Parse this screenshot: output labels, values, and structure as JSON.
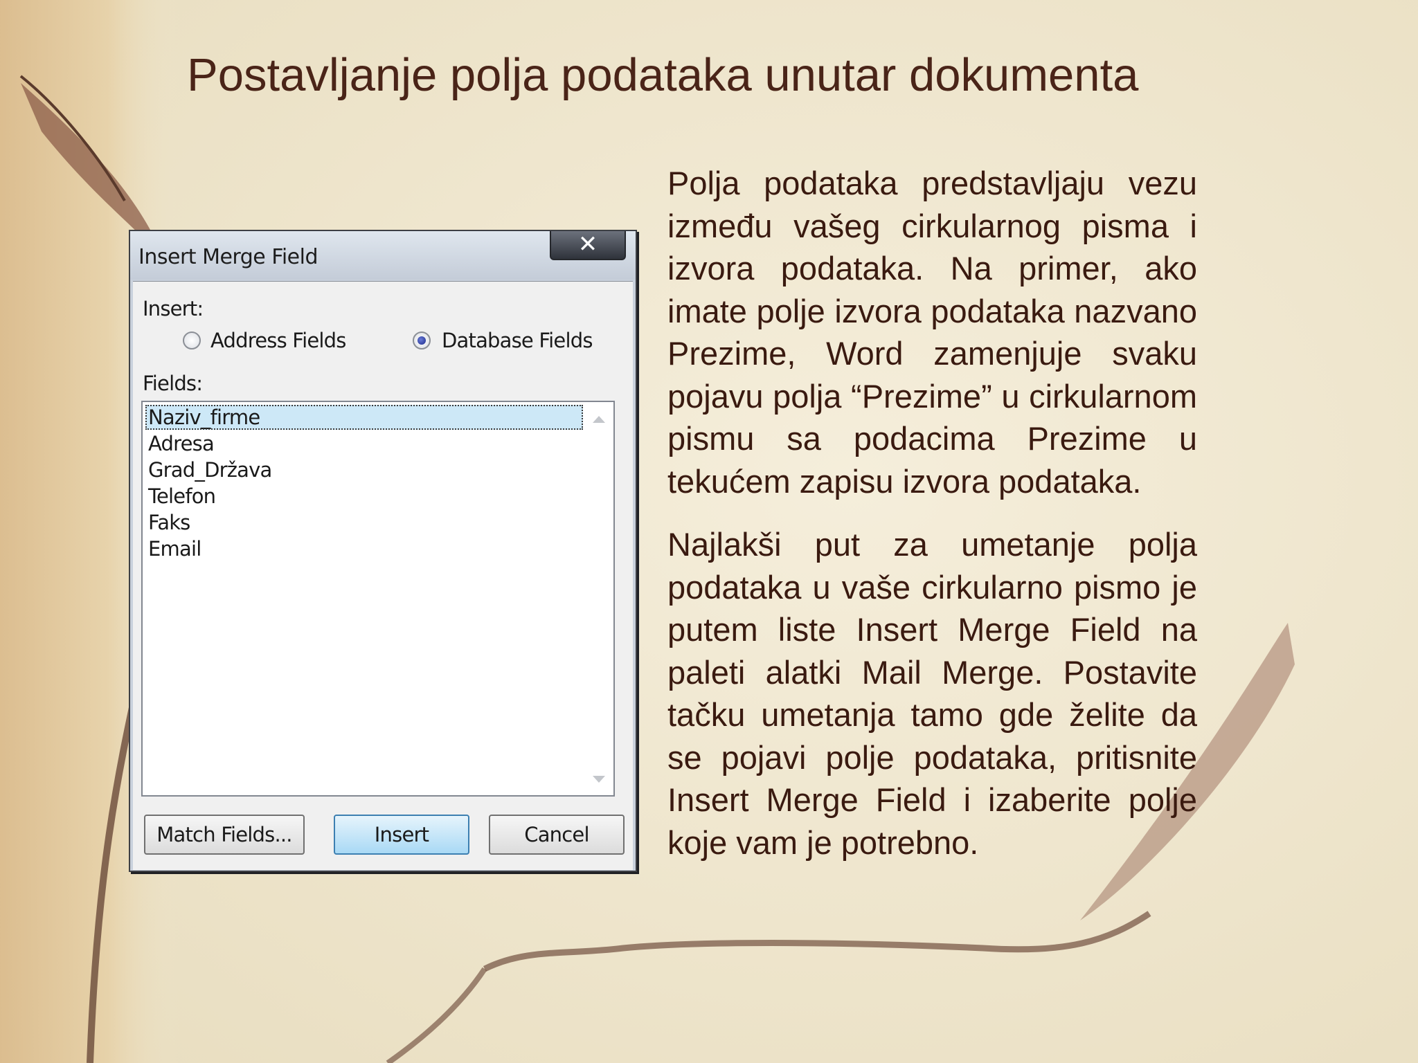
{
  "slide": {
    "title": "Postavljanje polja podataka unutar dokumenta",
    "paragraphs": [
      "Polja podataka predstavljaju vezu između vašeg cirkularnog pisma i izvora podataka. Na primer, ako imate polje izvora podataka nazvano Prezime, Word zamenjuje svaku pojavu polja “Prezime” u cirkularnom pismu sa podacima Prezime u tekućem zapisu izvora podataka.",
      "Najlakši put za umetanje polja podataka u vaše cirkularno pismo je putem liste Insert Merge Field na paleti alatki Mail Merge. Postavite tačku umetanja tamo gde želite da se pojavi polje podataka, pritisnite Insert Merge Field i izaberite polje koje vam je potrebno."
    ]
  },
  "dialog": {
    "title": "Insert Merge Field",
    "close_icon": "x-close-icon",
    "insert_label": "Insert:",
    "radio_address": "Address Fields",
    "radio_database": "Database Fields",
    "selected_radio": "Database Fields",
    "fields_label": "Fields:",
    "fields": [
      "Naziv_firme",
      "Adresa",
      "Grad_Država",
      "Telefon",
      "Faks",
      "Email"
    ],
    "selected_field": "Naziv_firme",
    "buttons": {
      "match": "Match Fields...",
      "insert": "Insert",
      "cancel": "Cancel"
    }
  },
  "colors": {
    "title_text": "#4a2418",
    "body_text": "#3a1a10",
    "background": "#efe6cc",
    "selection": "#cde8f7"
  }
}
